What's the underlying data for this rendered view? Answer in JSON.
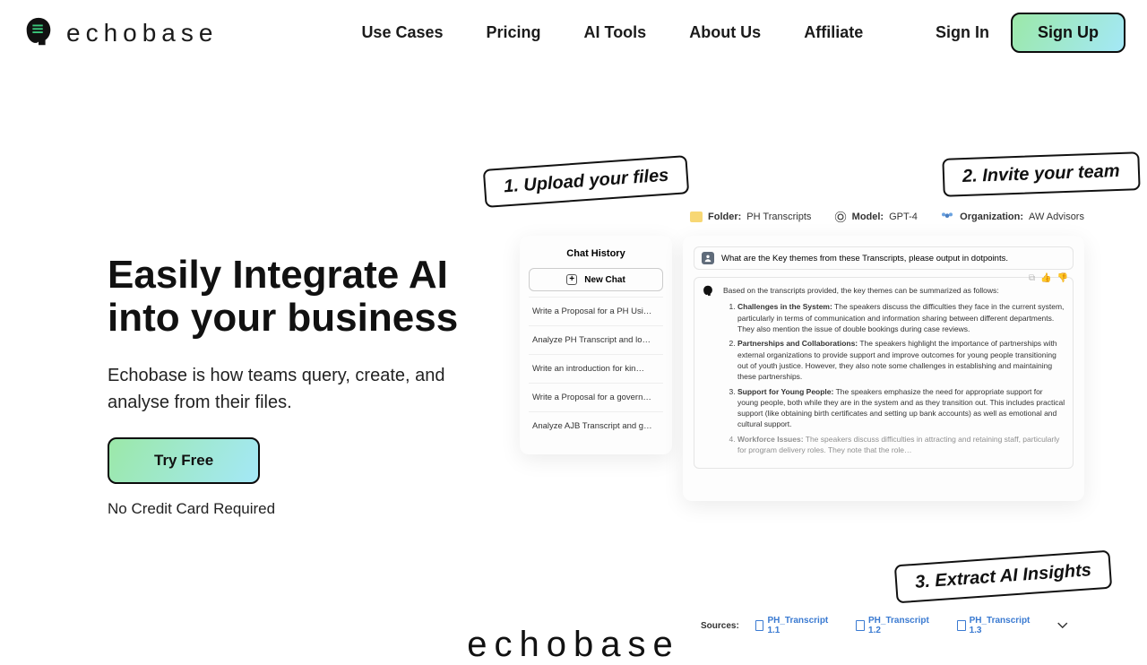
{
  "brand": "echobase",
  "nav": {
    "use_cases": "Use Cases",
    "pricing": "Pricing",
    "ai_tools": "AI Tools",
    "about_us": "About Us",
    "affiliate": "Affiliate"
  },
  "auth": {
    "signin": "Sign In",
    "signup": "Sign Up"
  },
  "hero": {
    "headline": "Easily Integrate AI into your business",
    "subhead": "Echobase is how teams query, create, and analyse from their files.",
    "try_free": "Try Free",
    "no_card": "No Credit Card Required"
  },
  "callouts": {
    "c1": "1. Upload your files",
    "c2": "2. Invite your team",
    "c3": "3. Extract AI Insights"
  },
  "meta": {
    "folder_label": "Folder:",
    "folder_value": "PH Transcripts",
    "model_label": "Model:",
    "model_value": "GPT-4",
    "org_label": "Organization:",
    "org_value": "AW Advisors"
  },
  "chat_history": {
    "title": "Chat History",
    "new_chat": "New Chat",
    "items": [
      "Write a Proposal for a PH Usi…",
      "Analyze PH Transcript and lo…",
      "Write an introduction for kin…",
      "Write a Proposal for a govern…",
      "Analyze AJB Transcript and g…"
    ]
  },
  "prompt": "What are the Key themes from these Transcripts, please output in dotpoints.",
  "answer": {
    "intro": "Based on the transcripts provided, the key themes can be summarized as follows:",
    "themes": [
      {
        "title": "Challenges in the System:",
        "body": "The speakers discuss the difficulties they face in the current system, particularly in terms of communication and information sharing between different departments. They also mention the issue of double bookings during case reviews."
      },
      {
        "title": "Partnerships and Collaborations:",
        "body": "The speakers highlight the importance of partnerships with external organizations to provide support and improve outcomes for young people transitioning out of youth justice. However, they also note some challenges in establishing and maintaining these partnerships."
      },
      {
        "title": "Support for Young People:",
        "body": "The speakers emphasize the need for appropriate support for young people, both while they are in the system and as they transition out. This includes practical support (like obtaining birth certificates and setting up bank accounts) as well as emotional and cultural support."
      },
      {
        "title": "Workforce Issues:",
        "body": "The speakers discuss difficulties in attracting and retaining staff, particularly for program delivery roles. They note that the role…"
      }
    ]
  },
  "sources": {
    "label": "Sources:",
    "items": [
      "PH_Transcript 1.1",
      "PH_Transcript 1.2",
      "PH_Transcript 1.3"
    ]
  },
  "bottom_mark": "echobase"
}
